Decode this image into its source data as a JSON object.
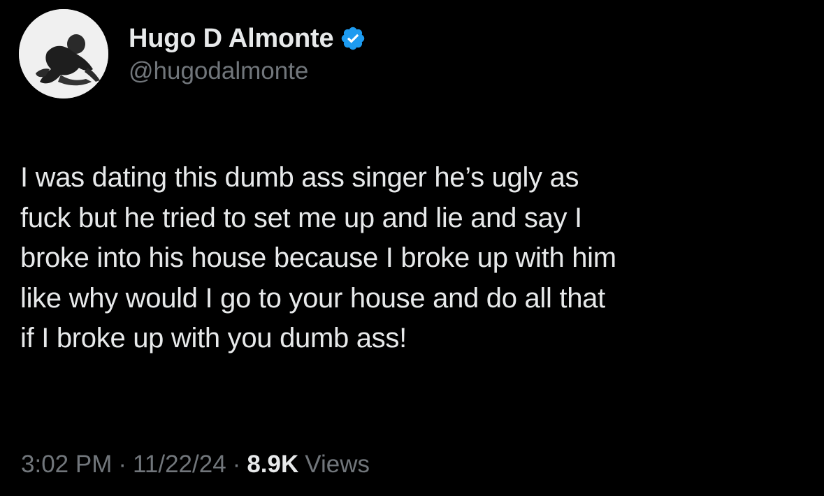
{
  "author": {
    "display_name": "Hugo D Almonte",
    "handle": "@hugodalmonte",
    "verified_icon": "verified-badge-icon",
    "avatar": "profile-photo"
  },
  "tweet": {
    "text": "I was dating this dumb ass singer he’s ugly as\nfuck but he tried to set me up and lie and say I\nbroke into his house because I broke up with him\nlike why would I go to your house and do all that\nif I broke up with you dumb ass!"
  },
  "meta": {
    "time": "3:02 PM",
    "separator": "·",
    "date": "11/22/24",
    "views_count": "8.9K",
    "views_label": "Views"
  },
  "colors": {
    "background": "#000000",
    "primary_text": "#e7e9ea",
    "secondary_text": "#71767b",
    "verified_blue": "#1d9bf0"
  }
}
